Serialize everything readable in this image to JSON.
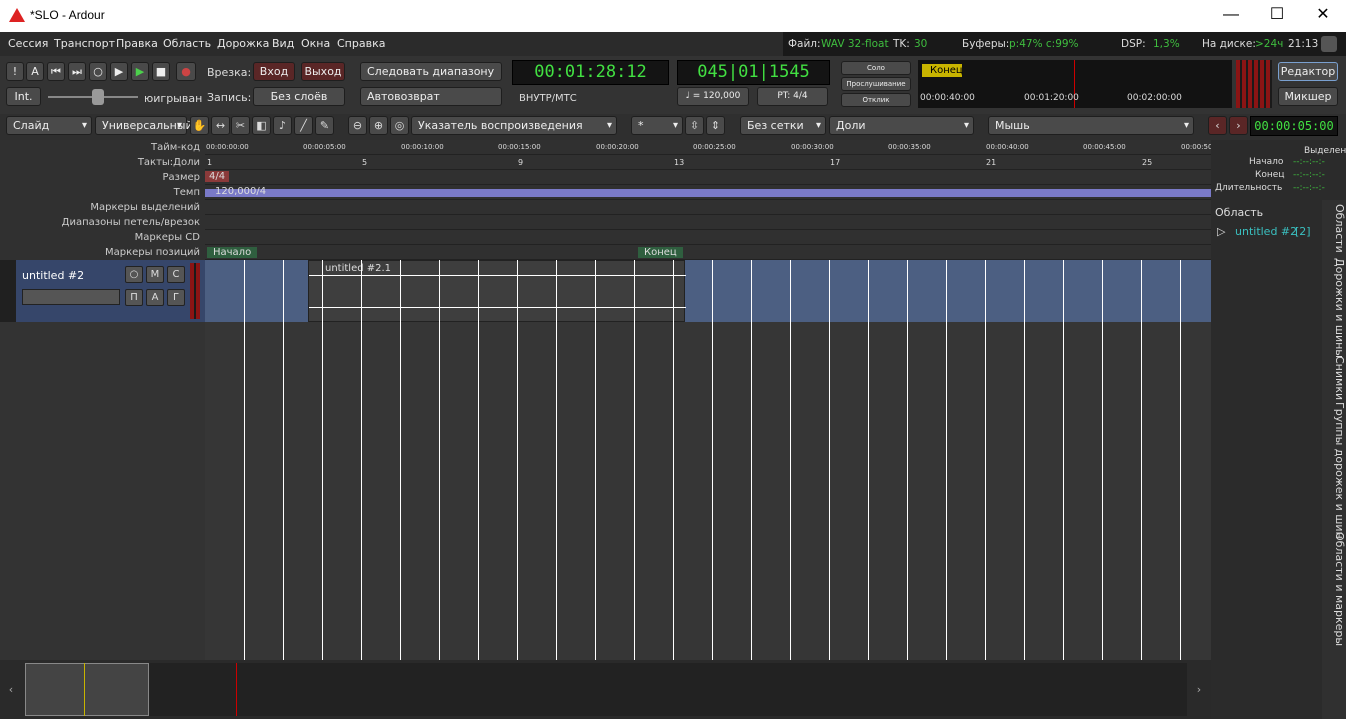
{
  "window": {
    "title": "*SLO - Ardour",
    "min": "—",
    "max": "☐",
    "close": "✕"
  },
  "menu": [
    "Сессия",
    "Транспорт",
    "Правка",
    "Область",
    "Дорожка",
    "Вид",
    "Окна",
    "Справка"
  ],
  "status": {
    "file_label": "Файл:",
    "file_value": "WAV 32-float",
    "tk_label": "TK:",
    "tk_value": "30",
    "buf_label": "Буферы:",
    "buf_value": "p:47% c:99%",
    "dsp_label": "DSP:",
    "dsp_value": "1,3%",
    "disk_label": "На диске:",
    "disk_value": ">24ч",
    "time": "21:13"
  },
  "transport": {
    "int_label": "Int.",
    "shuttle_label": "юигрыван",
    "punch_label": "Врезка:",
    "punch_in": "Вход",
    "punch_out": "Выход",
    "rec_label": "Запись:",
    "rec_mode": "Без слоёв",
    "follow_range": "Следовать диапазону",
    "auto_return": "Автовозврат",
    "primary_clock": "00:01:28:12",
    "primary_sub": "ВНУТР/МТС",
    "secondary_clock": "045|01|1545",
    "tempo": "♩ = 120,000",
    "meter": "PT: 4/4",
    "solo": "Соло",
    "audition": "Прослушивание",
    "feedback": "Отклик",
    "mini_marker": "Конец",
    "mini_times": [
      "00:00:40:00",
      "00:01:20:00",
      "00:02:00:00"
    ],
    "editor_btn": "Редактор",
    "mixer_btn": "Микшер"
  },
  "toolbar2": {
    "edit_mode": "Слайд",
    "ripple": "Универсальный",
    "edit_point": "Указатель воспроизведения",
    "nudge": "*",
    "grid": "Без сетки",
    "grid_type": "Доли",
    "mouse": "Мышь",
    "nudge_clock": "00:00:05:00"
  },
  "rulers": {
    "labels": [
      "Тайм-код",
      "Такты:Доли",
      "Размер",
      "Темп",
      "Маркеры выделений",
      "Диапазоны петель/врезок",
      "Маркеры CD",
      "Маркеры позиций"
    ],
    "timecodes": [
      "00:00:00:00",
      "00:00:05:00",
      "00:00:10:00",
      "00:00:15:00",
      "00:00:20:00",
      "00:00:25:00",
      "00:00:30:00",
      "00:00:35:00",
      "00:00:40:00",
      "00:00:45:00",
      "00:00:50"
    ],
    "bars": [
      "1",
      "5",
      "9",
      "13",
      "17",
      "21",
      "25"
    ],
    "meter": "4/4",
    "tempo": "120,000/4",
    "start_marker": "Начало",
    "end_marker": "Конец"
  },
  "track": {
    "name": "untitled #2",
    "region_name": "untitled #2.1",
    "rec": "○",
    "mute": "М",
    "solo": "С",
    "p": "П",
    "a": "А",
    "g": "Г"
  },
  "right": {
    "sel_title": "Выделен",
    "start": "Начало",
    "end": "Конец",
    "len": "Длительность",
    "dashes": "--:--:--:-",
    "regions_title": "Область",
    "region_item": "untitled #2",
    "region_count": "[2]",
    "tabs": [
      "Области",
      "Дорожки и шины",
      "Снимки",
      "Группы дорожек и шин",
      "Области и маркеры"
    ]
  }
}
